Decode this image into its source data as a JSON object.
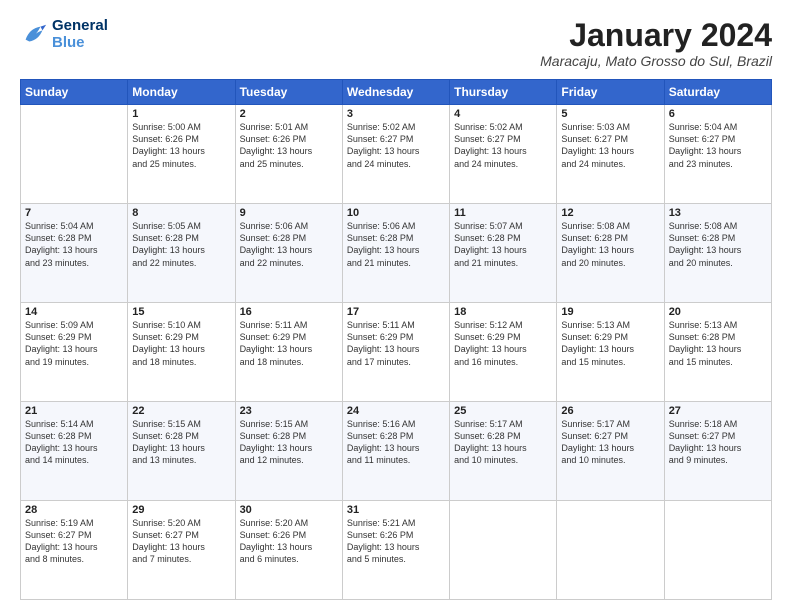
{
  "logo": {
    "line1": "General",
    "line2": "Blue"
  },
  "title": "January 2024",
  "subtitle": "Maracaju, Mato Grosso do Sul, Brazil",
  "header": {
    "days": [
      "Sunday",
      "Monday",
      "Tuesday",
      "Wednesday",
      "Thursday",
      "Friday",
      "Saturday"
    ]
  },
  "weeks": [
    {
      "days": [
        {
          "num": "",
          "info": ""
        },
        {
          "num": "1",
          "info": "Sunrise: 5:00 AM\nSunset: 6:26 PM\nDaylight: 13 hours\nand 25 minutes."
        },
        {
          "num": "2",
          "info": "Sunrise: 5:01 AM\nSunset: 6:26 PM\nDaylight: 13 hours\nand 25 minutes."
        },
        {
          "num": "3",
          "info": "Sunrise: 5:02 AM\nSunset: 6:27 PM\nDaylight: 13 hours\nand 24 minutes."
        },
        {
          "num": "4",
          "info": "Sunrise: 5:02 AM\nSunset: 6:27 PM\nDaylight: 13 hours\nand 24 minutes."
        },
        {
          "num": "5",
          "info": "Sunrise: 5:03 AM\nSunset: 6:27 PM\nDaylight: 13 hours\nand 24 minutes."
        },
        {
          "num": "6",
          "info": "Sunrise: 5:04 AM\nSunset: 6:27 PM\nDaylight: 13 hours\nand 23 minutes."
        }
      ]
    },
    {
      "days": [
        {
          "num": "7",
          "info": "Sunrise: 5:04 AM\nSunset: 6:28 PM\nDaylight: 13 hours\nand 23 minutes."
        },
        {
          "num": "8",
          "info": "Sunrise: 5:05 AM\nSunset: 6:28 PM\nDaylight: 13 hours\nand 22 minutes."
        },
        {
          "num": "9",
          "info": "Sunrise: 5:06 AM\nSunset: 6:28 PM\nDaylight: 13 hours\nand 22 minutes."
        },
        {
          "num": "10",
          "info": "Sunrise: 5:06 AM\nSunset: 6:28 PM\nDaylight: 13 hours\nand 21 minutes."
        },
        {
          "num": "11",
          "info": "Sunrise: 5:07 AM\nSunset: 6:28 PM\nDaylight: 13 hours\nand 21 minutes."
        },
        {
          "num": "12",
          "info": "Sunrise: 5:08 AM\nSunset: 6:28 PM\nDaylight: 13 hours\nand 20 minutes."
        },
        {
          "num": "13",
          "info": "Sunrise: 5:08 AM\nSunset: 6:28 PM\nDaylight: 13 hours\nand 20 minutes."
        }
      ]
    },
    {
      "days": [
        {
          "num": "14",
          "info": "Sunrise: 5:09 AM\nSunset: 6:29 PM\nDaylight: 13 hours\nand 19 minutes."
        },
        {
          "num": "15",
          "info": "Sunrise: 5:10 AM\nSunset: 6:29 PM\nDaylight: 13 hours\nand 18 minutes."
        },
        {
          "num": "16",
          "info": "Sunrise: 5:11 AM\nSunset: 6:29 PM\nDaylight: 13 hours\nand 18 minutes."
        },
        {
          "num": "17",
          "info": "Sunrise: 5:11 AM\nSunset: 6:29 PM\nDaylight: 13 hours\nand 17 minutes."
        },
        {
          "num": "18",
          "info": "Sunrise: 5:12 AM\nSunset: 6:29 PM\nDaylight: 13 hours\nand 16 minutes."
        },
        {
          "num": "19",
          "info": "Sunrise: 5:13 AM\nSunset: 6:29 PM\nDaylight: 13 hours\nand 15 minutes."
        },
        {
          "num": "20",
          "info": "Sunrise: 5:13 AM\nSunset: 6:28 PM\nDaylight: 13 hours\nand 15 minutes."
        }
      ]
    },
    {
      "days": [
        {
          "num": "21",
          "info": "Sunrise: 5:14 AM\nSunset: 6:28 PM\nDaylight: 13 hours\nand 14 minutes."
        },
        {
          "num": "22",
          "info": "Sunrise: 5:15 AM\nSunset: 6:28 PM\nDaylight: 13 hours\nand 13 minutes."
        },
        {
          "num": "23",
          "info": "Sunrise: 5:15 AM\nSunset: 6:28 PM\nDaylight: 13 hours\nand 12 minutes."
        },
        {
          "num": "24",
          "info": "Sunrise: 5:16 AM\nSunset: 6:28 PM\nDaylight: 13 hours\nand 11 minutes."
        },
        {
          "num": "25",
          "info": "Sunrise: 5:17 AM\nSunset: 6:28 PM\nDaylight: 13 hours\nand 10 minutes."
        },
        {
          "num": "26",
          "info": "Sunrise: 5:17 AM\nSunset: 6:27 PM\nDaylight: 13 hours\nand 10 minutes."
        },
        {
          "num": "27",
          "info": "Sunrise: 5:18 AM\nSunset: 6:27 PM\nDaylight: 13 hours\nand 9 minutes."
        }
      ]
    },
    {
      "days": [
        {
          "num": "28",
          "info": "Sunrise: 5:19 AM\nSunset: 6:27 PM\nDaylight: 13 hours\nand 8 minutes."
        },
        {
          "num": "29",
          "info": "Sunrise: 5:20 AM\nSunset: 6:27 PM\nDaylight: 13 hours\nand 7 minutes."
        },
        {
          "num": "30",
          "info": "Sunrise: 5:20 AM\nSunset: 6:26 PM\nDaylight: 13 hours\nand 6 minutes."
        },
        {
          "num": "31",
          "info": "Sunrise: 5:21 AM\nSunset: 6:26 PM\nDaylight: 13 hours\nand 5 minutes."
        },
        {
          "num": "",
          "info": ""
        },
        {
          "num": "",
          "info": ""
        },
        {
          "num": "",
          "info": ""
        }
      ]
    }
  ]
}
